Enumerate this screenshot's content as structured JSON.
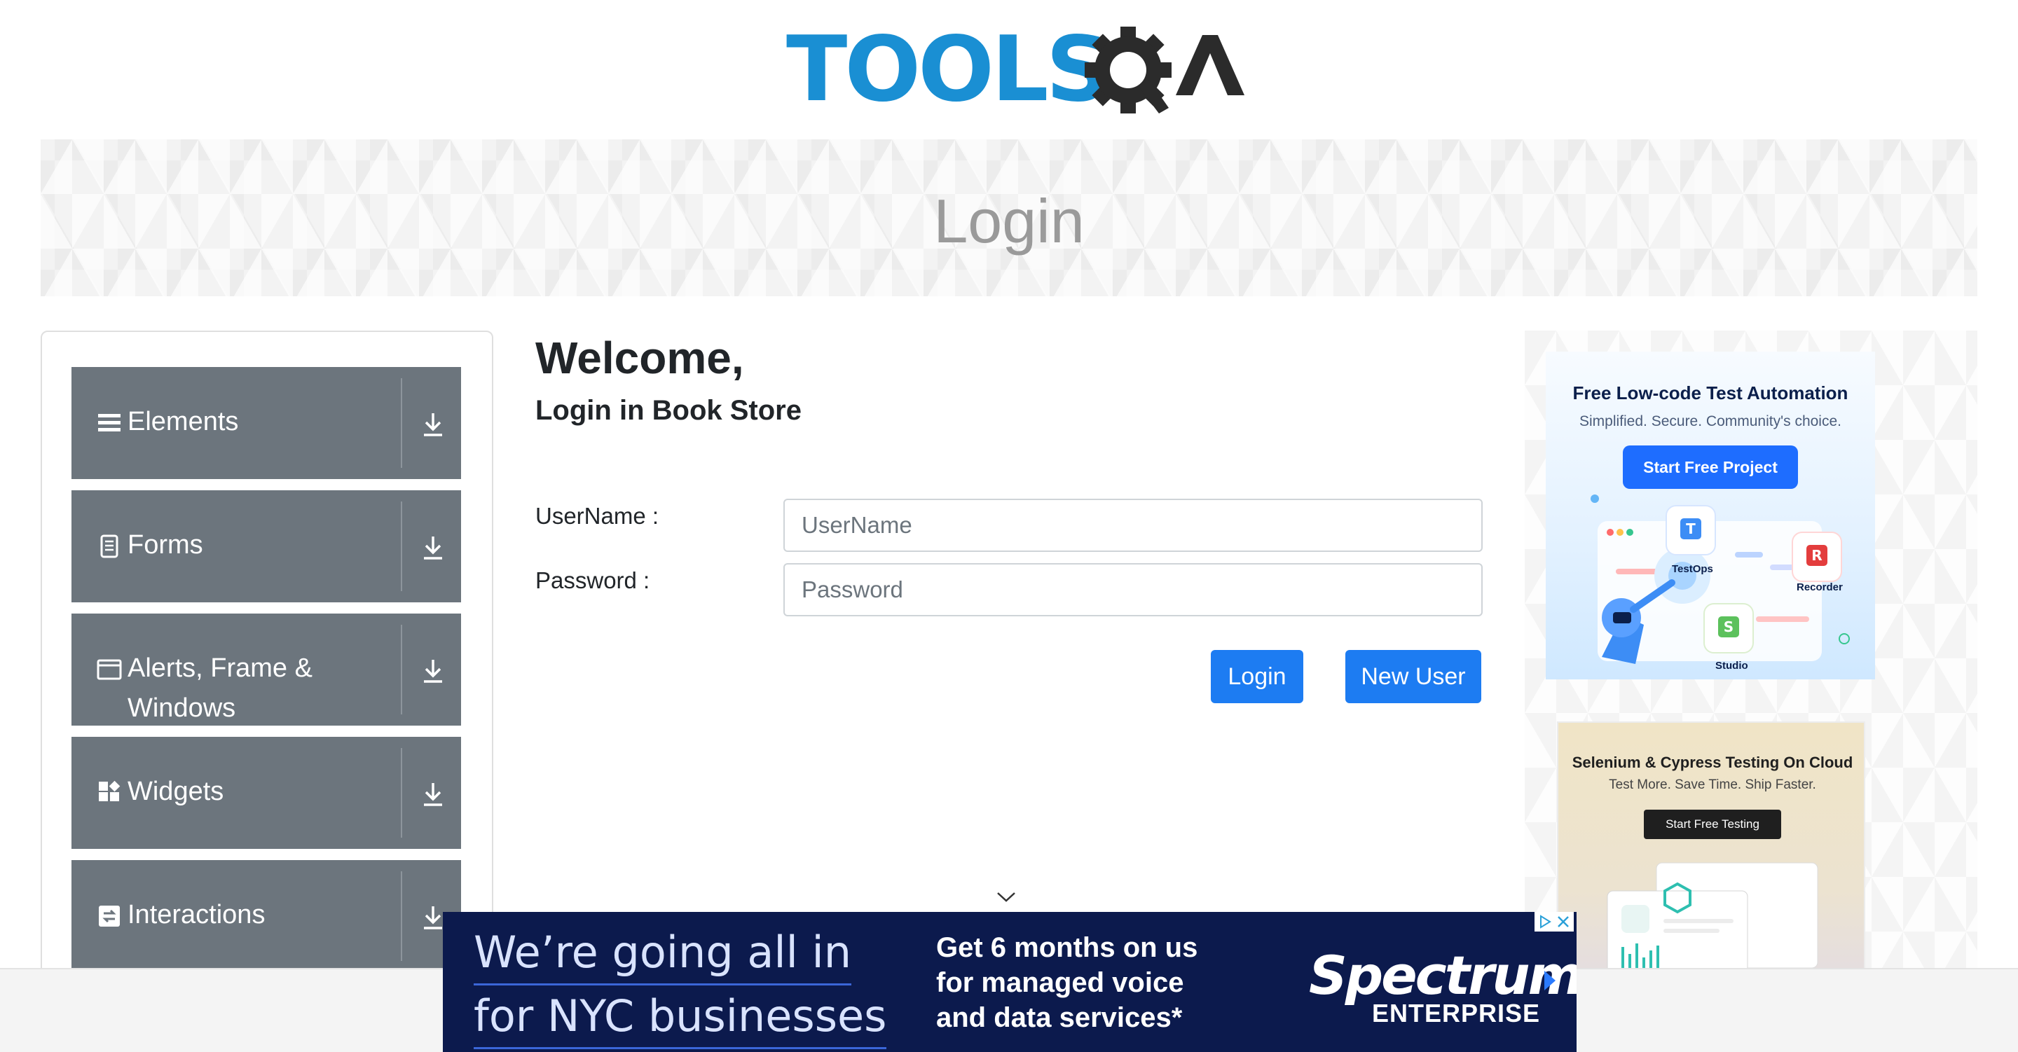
{
  "logo": {
    "text": "TOOLS",
    "alt": "ToolsQA"
  },
  "banner": {
    "title": "Login"
  },
  "sidebar": {
    "groups": [
      {
        "label": "Elements",
        "icon": "hamburger-icon"
      },
      {
        "label": "Forms",
        "icon": "document-icon"
      },
      {
        "label": "Alerts, Frame & Windows",
        "icon": "window-icon"
      },
      {
        "label": "Widgets",
        "icon": "widgets-icon"
      },
      {
        "label": "Interactions",
        "icon": "interactions-icon"
      }
    ],
    "collapse_icon": "download-arrow-icon"
  },
  "form": {
    "welcome": "Welcome,",
    "subtitle": "Login in Book Store",
    "username_label": "UserName :",
    "username_placeholder": "UserName",
    "username_value": "",
    "password_label": "Password :",
    "password_placeholder": "Password",
    "password_value": "",
    "login_label": "Login",
    "new_user_label": "New User"
  },
  "ads": {
    "katalon": {
      "title": "Free Low-code Test Automation",
      "tagline": "Simplified. Secure. Community's choice.",
      "cta": "Start Free Project",
      "products": [
        "TestOps",
        "Recorder",
        "Studio"
      ]
    },
    "lambdatest": {
      "title": "Selenium & Cypress Testing On Cloud",
      "tagline": "Test More. Save Time. Ship Faster.",
      "cta": "Start Free Testing"
    },
    "spectrum": {
      "headline_1": "We’re going all in",
      "headline_2": "for NYC businesses",
      "offer_1": "Get 6 months on us",
      "offer_2": "for managed voice",
      "offer_3": "and data services*",
      "brand": "Spectrum",
      "brand_sub": "ENTERPRISE"
    }
  },
  "colors": {
    "sidebar_group": "#6c757d",
    "primary_button": "#1d7cf2",
    "logo_blue": "#1a8fd3",
    "spectrum_navy": "#0c1a4d"
  }
}
